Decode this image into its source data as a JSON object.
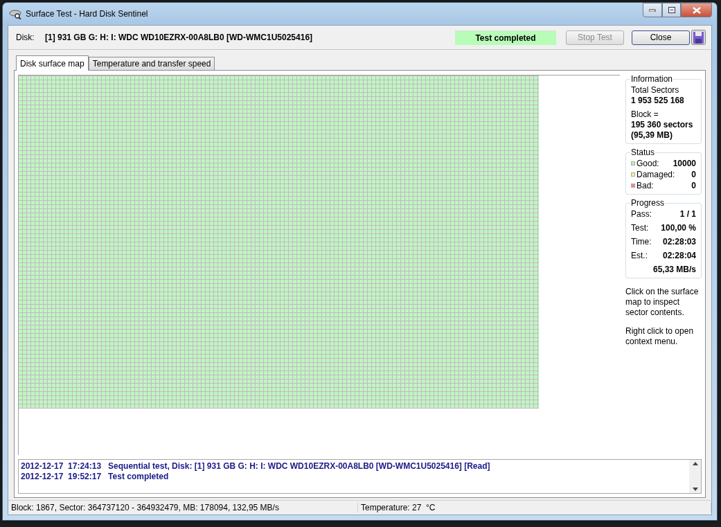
{
  "window": {
    "title": "Surface Test - Hard Disk Sentinel"
  },
  "toolbar": {
    "disk_label": "Disk:",
    "disk_value": "[1] 931 GB G: H: I: WDC WD10EZRX-00A8LB0 [WD-WMC1U5025416]",
    "status": "Test completed",
    "buttons": [
      {
        "label": "Stop Test",
        "disabled": true
      },
      {
        "label": "Close",
        "disabled": false
      }
    ]
  },
  "tabs": [
    {
      "label": "Disk surface map",
      "selected": true
    },
    {
      "label": "Temperature and transfer speed",
      "selected": false
    }
  ],
  "information": {
    "title": "Information",
    "total_label": "Total Sectors",
    "total_value": "1 953 525 168",
    "block_label": "Block =",
    "block_value": "195 360 sectors",
    "block_size": "(95,39 MB)"
  },
  "status": {
    "title": "Status",
    "items": [
      {
        "label": "Good:",
        "value": "10000",
        "color": "#b8f0b8"
      },
      {
        "label": "Damaged:",
        "value": "0",
        "color": "#f0f0a0"
      },
      {
        "label": "Bad:",
        "value": "0",
        "color": "#f08888"
      }
    ]
  },
  "progress": {
    "title": "Progress",
    "rows": [
      {
        "label": "Pass:",
        "value": "1 / 1"
      },
      {
        "label": "Test:",
        "value": "100,00 %"
      },
      {
        "label": "Time:",
        "value": "02:28:03"
      },
      {
        "label": "Est.:",
        "value": "02:28:04"
      }
    ],
    "speed": "65,33 MB/s"
  },
  "hints": [
    "Click on the surface map to inspect sector contents.",
    "Right click to open context menu."
  ],
  "log": [
    {
      "text": "2012-12-17  17:24:13   Sequential test, Disk: [1] 931 GB G: H: I: WDC WD10EZRX-00A8LB0 [WD-WMC1U5025416] [Read]"
    },
    {
      "text": "2012-12-17  19:52:17   Test completed"
    }
  ],
  "status_bar": [
    "Block: 1867, Sector: 364737120 - 364932479, MB: 178094, 132,95 MB/s",
    "Temperature: 27  °C"
  ]
}
